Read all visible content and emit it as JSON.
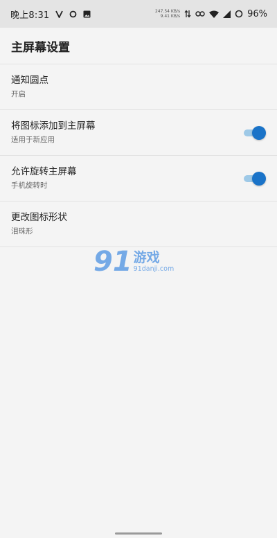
{
  "status_bar": {
    "time": "晚上8:31",
    "net_speed_up": "247.54 KB/s",
    "net_speed_down": "9.41 KB/s",
    "battery": "96%"
  },
  "app_bar": {
    "title": "主屏幕设置"
  },
  "settings": [
    {
      "title": "通知圆点",
      "summary": "开启"
    },
    {
      "title": "将图标添加到主屏幕",
      "summary": "适用于新应用",
      "toggle_on": true
    },
    {
      "title": "允许旋转主屏幕",
      "summary": "手机旋转时",
      "toggle_on": true
    },
    {
      "title": "更改图标形状",
      "summary": "泪珠形"
    }
  ],
  "watermark": {
    "number": "91",
    "text": "游戏",
    "url": "91danji.com"
  },
  "colors": {
    "accent": "#1a73c8",
    "track": "#9ec9e7"
  }
}
